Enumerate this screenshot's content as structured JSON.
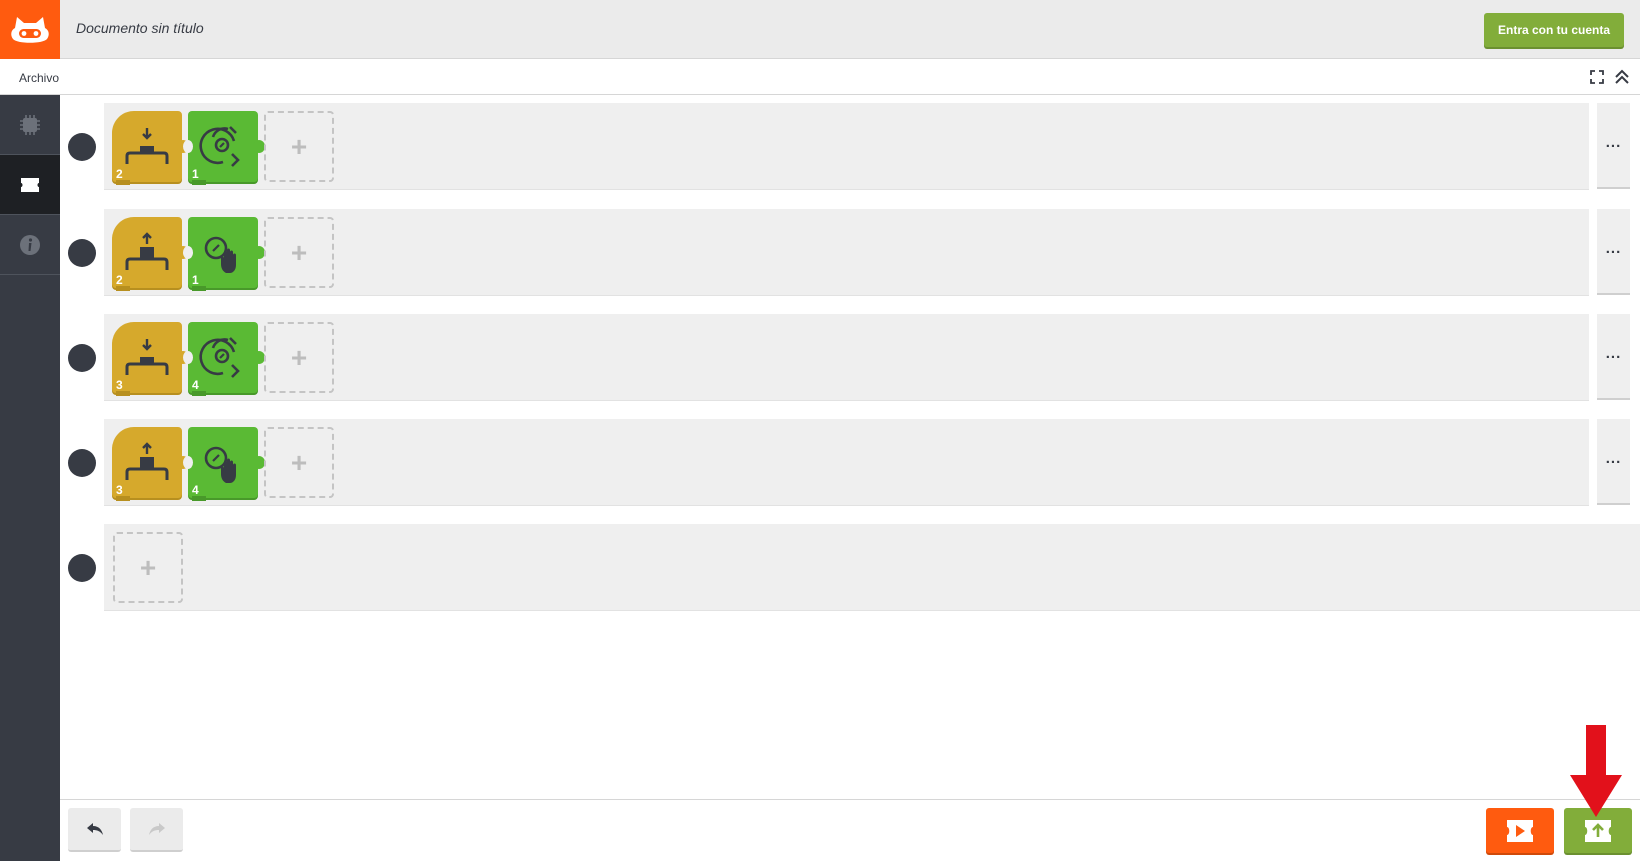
{
  "header": {
    "document_title": "Documento sin título",
    "login_label": "Entra con tu cuenta"
  },
  "menubar": {
    "archivo_label": "Archivo"
  },
  "sidebar": {
    "items": [
      {
        "icon": "chip-icon",
        "active": false
      },
      {
        "icon": "blocks-icon",
        "active": true
      },
      {
        "icon": "info-icon",
        "active": false
      }
    ]
  },
  "rows": [
    {
      "blocks": [
        {
          "type": "wait-until-pressed",
          "color": "yellow",
          "number": "2"
        },
        {
          "type": "servo-rotate-continuous",
          "color": "green",
          "number": "1"
        }
      ]
    },
    {
      "blocks": [
        {
          "type": "wait-until-released",
          "color": "yellow",
          "number": "2"
        },
        {
          "type": "servo-stop",
          "color": "green",
          "number": "1"
        }
      ]
    },
    {
      "blocks": [
        {
          "type": "wait-until-pressed",
          "color": "yellow",
          "number": "3"
        },
        {
          "type": "servo-rotate-continuous",
          "color": "green",
          "number": "4"
        }
      ]
    },
    {
      "blocks": [
        {
          "type": "wait-until-released",
          "color": "yellow",
          "number": "3"
        },
        {
          "type": "servo-stop",
          "color": "green",
          "number": "4"
        }
      ]
    },
    {
      "blocks": []
    }
  ],
  "row_menu_label": "...",
  "add_slot_label": "+",
  "colors": {
    "brand_orange": "#ff5b0f",
    "accent_green": "#82ad3a",
    "block_yellow": "#d6a92c",
    "block_green": "#5aba34",
    "sidebar_dark": "#373b44",
    "highlight_red": "#e2111b"
  },
  "footer": {
    "undo_icon": "undo-icon",
    "redo_icon": "redo-icon",
    "run_icon": "run-icon",
    "upload_icon": "upload-icon"
  }
}
